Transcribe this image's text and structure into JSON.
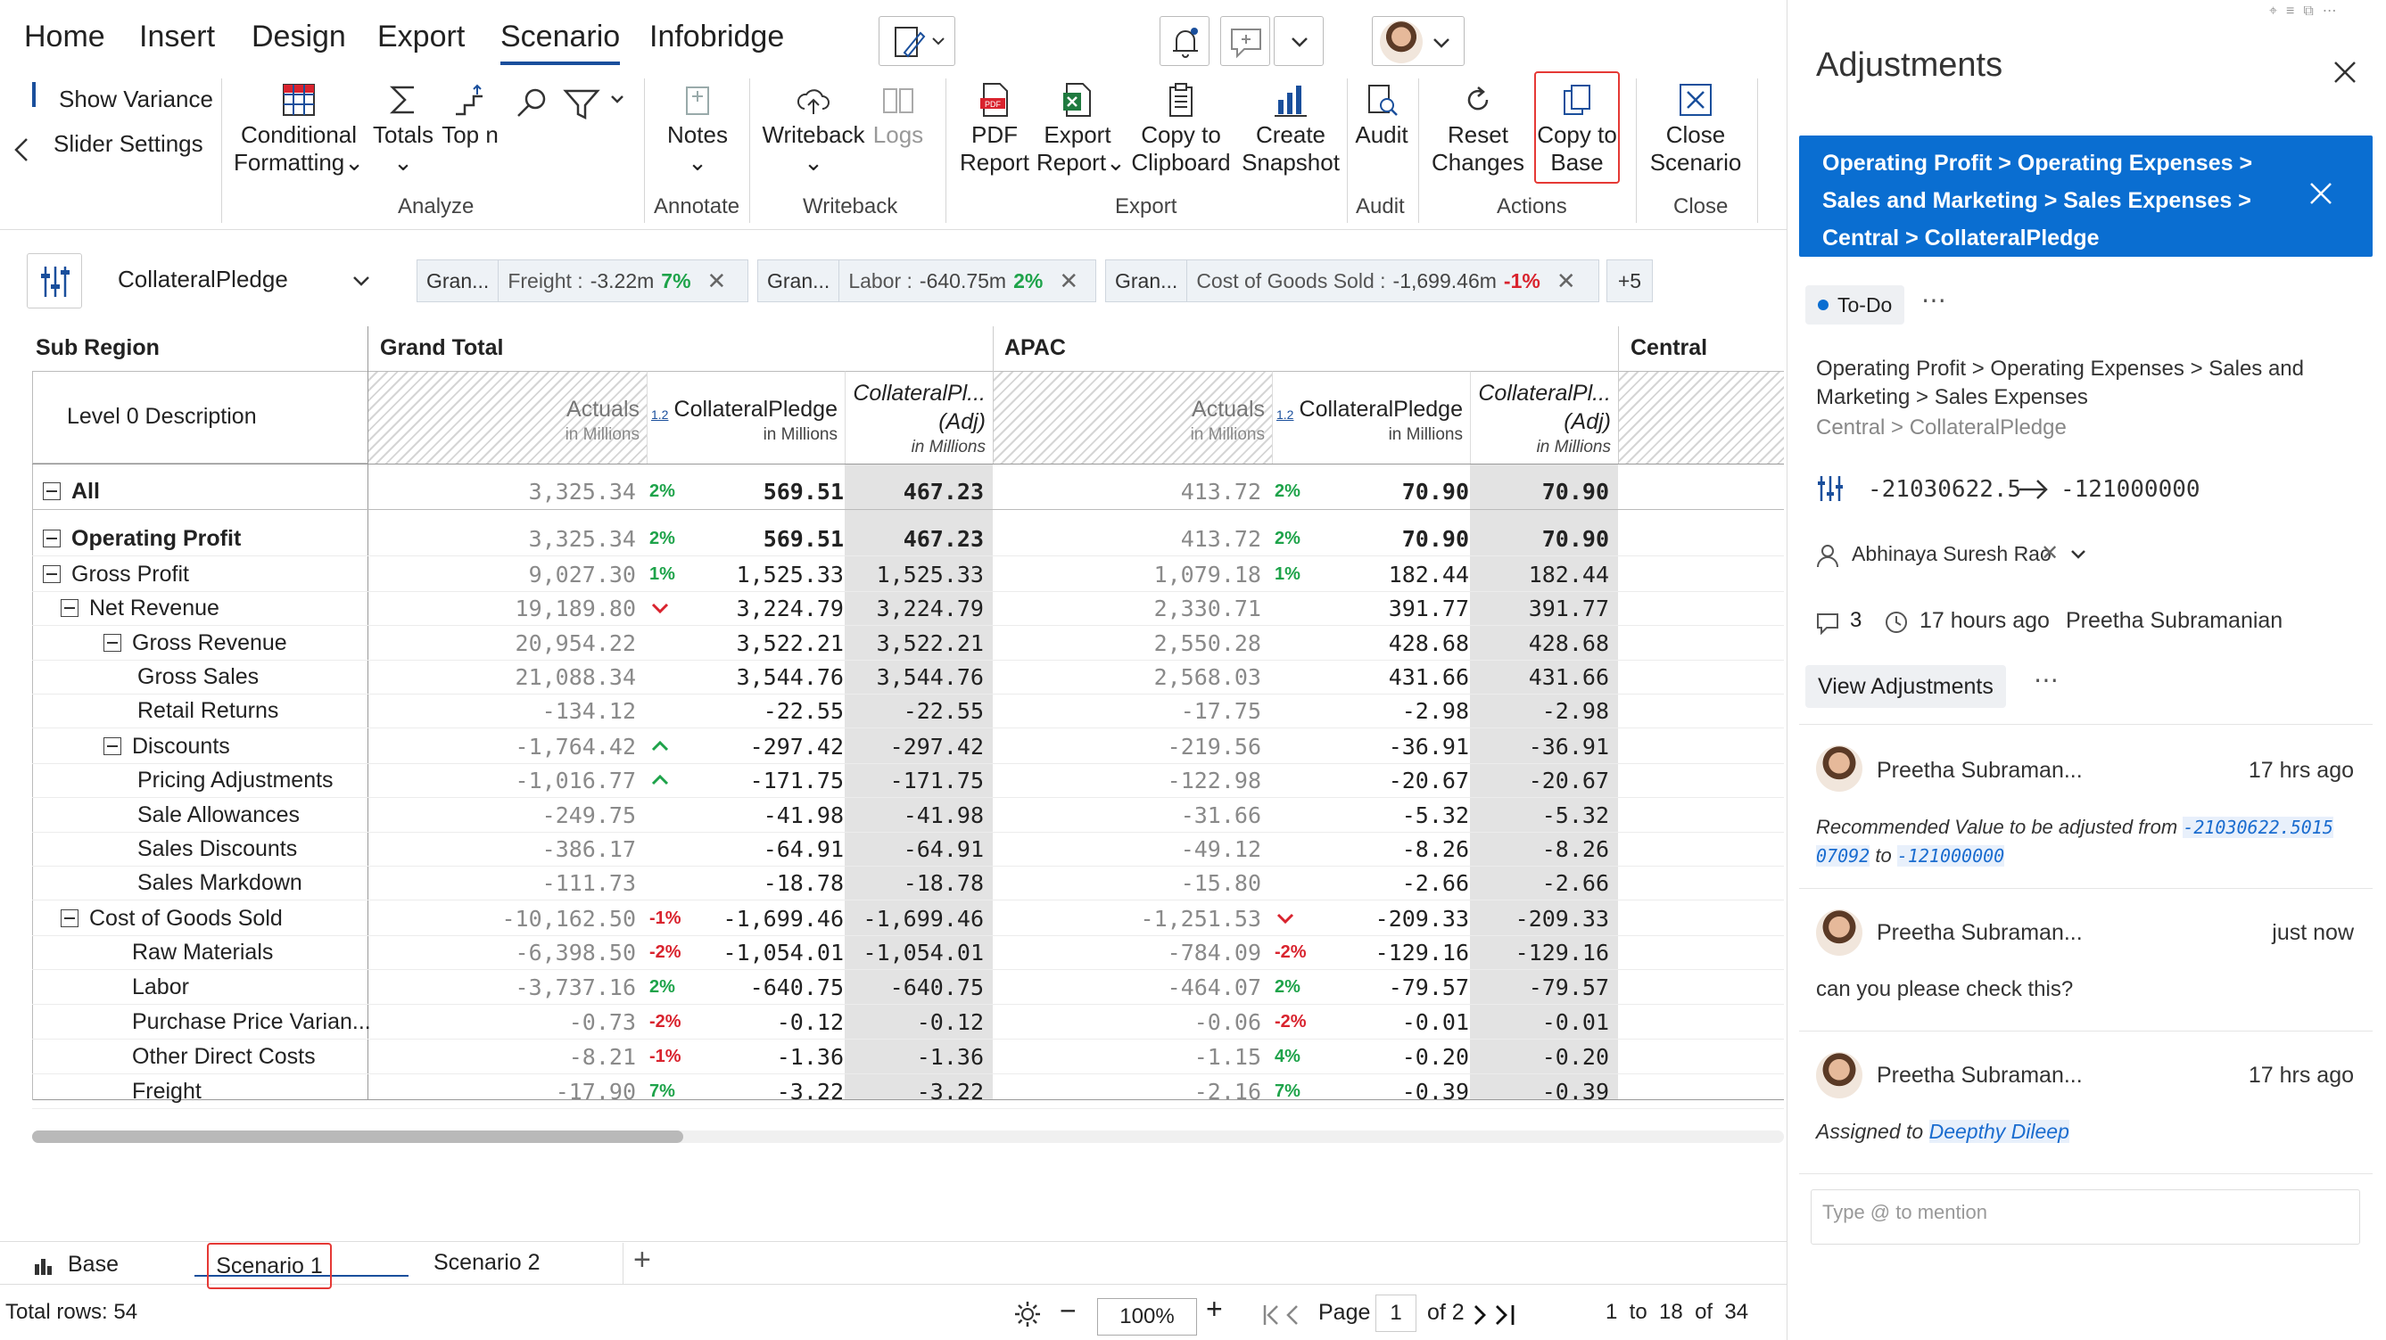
{
  "menu": {
    "tabs": [
      "Home",
      "Insert",
      "Design",
      "Export",
      "Scenario",
      "Infobridge"
    ],
    "active": "Scenario"
  },
  "ribbon": {
    "show_variance": "Show Variance",
    "slider_settings": "Slider Settings",
    "conditional_formatting": [
      "Conditional",
      "Formatting"
    ],
    "totals": "Totals",
    "top_n": "Top n",
    "notes": "Notes",
    "writeback": "Writeback",
    "logs": "Logs",
    "pdf_report": [
      "PDF",
      "Report"
    ],
    "export_report": [
      "Export",
      "Report"
    ],
    "copy_clipboard": [
      "Copy to",
      "Clipboard"
    ],
    "create_snapshot": [
      "Create",
      "Snapshot"
    ],
    "audit": "Audit",
    "reset_changes": [
      "Reset",
      "Changes"
    ],
    "copy_to_base": [
      "Copy to",
      "Base"
    ],
    "close_scenario": [
      "Close",
      "Scenario"
    ],
    "groups": {
      "analyze": "Analyze",
      "annotate": "Annotate",
      "writeback": "Writeback",
      "export": "Export",
      "audit": "Audit",
      "actions": "Actions",
      "close": "Close"
    }
  },
  "toolbar": {
    "measure_select": "CollateralPledge",
    "chips": [
      {
        "a": "Gran...",
        "label": "Freight :",
        "value": "-3.22m",
        "pct": "7%"
      },
      {
        "a": "Gran...",
        "label": "Labor :",
        "value": "-640.75m",
        "pct": "2%"
      },
      {
        "a": "Gran...",
        "label": "Cost of Goods Sold :",
        "value": "-1,699.46m",
        "pct": "-1%"
      }
    ],
    "more_chips": "+5"
  },
  "table": {
    "sub_region": "Sub Region",
    "level_desc": "Level 0 Description",
    "groups": [
      "Grand Total",
      "APAC",
      "Central"
    ],
    "col_actuals": "Actuals",
    "col_in_millions": "in Millions",
    "col_cp": "CollateralPledge",
    "col_cp_adj": "CollateralPl...",
    "col_adj": "(Adj)",
    "col_icon": "1.2",
    "rows": [
      {
        "label": "All",
        "indent": 0,
        "exp": true,
        "bold": true,
        "gt_act": "3,325.34",
        "gt_pct": "2%",
        "gt_cp": "569.51",
        "gt_adj": "467.23",
        "ap_act": "413.72",
        "ap_pct": "2%",
        "ap_cp": "70.90",
        "ap_adj": "70.90"
      },
      {
        "label": "Operating Profit",
        "indent": 0,
        "exp": true,
        "bold": true,
        "gt_act": "3,325.34",
        "gt_pct": "2%",
        "gt_cp": "569.51",
        "gt_adj": "467.23",
        "ap_act": "413.72",
        "ap_pct": "2%",
        "ap_cp": "70.90",
        "ap_adj": "70.90"
      },
      {
        "label": "Gross Profit",
        "indent": 1,
        "exp": true,
        "gt_act": "9,027.30",
        "gt_pct": "1%",
        "gt_cp": "1,525.33",
        "gt_adj": "1,525.33",
        "ap_act": "1,079.18",
        "ap_pct": "1%",
        "ap_cp": "182.44",
        "ap_adj": "182.44"
      },
      {
        "label": "Net Revenue",
        "indent": 2,
        "exp": true,
        "gt_act": "19,189.80",
        "gt_pct": "v",
        "gt_cp": "3,224.79",
        "gt_adj": "3,224.79",
        "ap_act": "2,330.71",
        "ap_pct": "",
        "ap_cp": "391.77",
        "ap_adj": "391.77"
      },
      {
        "label": "Gross Revenue",
        "indent": 3,
        "exp": true,
        "gt_act": "20,954.22",
        "gt_pct": "",
        "gt_cp": "3,522.21",
        "gt_adj": "3,522.21",
        "ap_act": "2,550.28",
        "ap_pct": "",
        "ap_cp": "428.68",
        "ap_adj": "428.68"
      },
      {
        "label": "Gross Sales",
        "indent": 4,
        "gt_act": "21,088.34",
        "gt_pct": "",
        "gt_cp": "3,544.76",
        "gt_adj": "3,544.76",
        "ap_act": "2,568.03",
        "ap_pct": "",
        "ap_cp": "431.66",
        "ap_adj": "431.66"
      },
      {
        "label": "Retail Returns",
        "indent": 4,
        "gt_act": "-134.12",
        "gt_pct": "",
        "gt_cp": "-22.55",
        "gt_adj": "-22.55",
        "ap_act": "-17.75",
        "ap_pct": "",
        "ap_cp": "-2.98",
        "ap_adj": "-2.98"
      },
      {
        "label": "Discounts",
        "indent": 3,
        "exp": true,
        "gt_act": "-1,764.42",
        "gt_pct": "^",
        "gt_cp": "-297.42",
        "gt_adj": "-297.42",
        "ap_act": "-219.56",
        "ap_pct": "",
        "ap_cp": "-36.91",
        "ap_adj": "-36.91"
      },
      {
        "label": "Pricing Adjustments",
        "indent": 4,
        "gt_act": "-1,016.77",
        "gt_pct": "^",
        "gt_cp": "-171.75",
        "gt_adj": "-171.75",
        "ap_act": "-122.98",
        "ap_pct": "",
        "ap_cp": "-20.67",
        "ap_adj": "-20.67"
      },
      {
        "label": "Sale Allowances",
        "indent": 4,
        "gt_act": "-249.75",
        "gt_pct": "",
        "gt_cp": "-41.98",
        "gt_adj": "-41.98",
        "ap_act": "-31.66",
        "ap_pct": "",
        "ap_cp": "-5.32",
        "ap_adj": "-5.32"
      },
      {
        "label": "Sales Discounts",
        "indent": 4,
        "gt_act": "-386.17",
        "gt_pct": "",
        "gt_cp": "-64.91",
        "gt_adj": "-64.91",
        "ap_act": "-49.12",
        "ap_pct": "",
        "ap_cp": "-8.26",
        "ap_adj": "-8.26"
      },
      {
        "label": "Sales Markdown",
        "indent": 4,
        "gt_act": "-111.73",
        "gt_pct": "",
        "gt_cp": "-18.78",
        "gt_adj": "-18.78",
        "ap_act": "-15.80",
        "ap_pct": "",
        "ap_cp": "-2.66",
        "ap_adj": "-2.66"
      },
      {
        "label": "Cost of Goods Sold",
        "indent": 2,
        "exp": true,
        "gt_act": "-10,162.50",
        "gt_pct": "-1%",
        "gt_cp": "-1,699.46",
        "gt_adj": "-1,699.46",
        "ap_act": "-1,251.53",
        "ap_pct": "v",
        "ap_cp": "-209.33",
        "ap_adj": "-209.33"
      },
      {
        "label": "Raw Materials",
        "indent": 3,
        "gt_act": "-6,398.50",
        "gt_pct": "-2%",
        "gt_cp": "-1,054.01",
        "gt_adj": "-1,054.01",
        "ap_act": "-784.09",
        "ap_pct": "-2%",
        "ap_cp": "-129.16",
        "ap_adj": "-129.16"
      },
      {
        "label": "Labor",
        "indent": 3,
        "gt_act": "-3,737.16",
        "gt_pct": "2%",
        "gt_cp": "-640.75",
        "gt_adj": "-640.75",
        "ap_act": "-464.07",
        "ap_pct": "2%",
        "ap_cp": "-79.57",
        "ap_adj": "-79.57"
      },
      {
        "label": "Purchase Price Varian...",
        "indent": 3,
        "gt_act": "-0.73",
        "gt_pct": "-2%",
        "gt_cp": "-0.12",
        "gt_adj": "-0.12",
        "ap_act": "-0.06",
        "ap_pct": "-2%",
        "ap_cp": "-0.01",
        "ap_adj": "-0.01"
      },
      {
        "label": "Other Direct Costs",
        "indent": 3,
        "gt_act": "-8.21",
        "gt_pct": "-1%",
        "gt_cp": "-1.36",
        "gt_adj": "-1.36",
        "ap_act": "-1.15",
        "ap_pct": "4%",
        "ap_cp": "-0.20",
        "ap_adj": "-0.20"
      },
      {
        "label": "Freight",
        "indent": 3,
        "gt_act": "-17.90",
        "gt_pct": "7%",
        "gt_cp": "-3.22",
        "gt_adj": "-3.22",
        "ap_act": "-2.16",
        "ap_pct": "7%",
        "ap_cp": "-0.39",
        "ap_adj": "-0.39"
      }
    ]
  },
  "bottom_tabs": {
    "base": "Base",
    "scenario1": "Scenario 1",
    "scenario2": "Scenario 2",
    "add": "+"
  },
  "status": {
    "total_rows": "Total rows: 54",
    "zoom": "100%",
    "page_label": "Page",
    "page_num": "1",
    "of_pages": "of 2",
    "range": "1  to  18  of  34"
  },
  "panel": {
    "title": "Adjustments",
    "banner": "Operating Profit > Operating Expenses > Sales and Marketing > Sales Expenses > Central > CollateralPledge",
    "status": "To-Do",
    "path1": "Operating Profit > Operating Expenses > Sales and Marketing > Sales Expenses",
    "path2": "Central > CollateralPledge",
    "from_value": "-21030622.5",
    "to_value": "-121000000",
    "assignee": "Abhinaya Suresh Rao",
    "comments_count": "3",
    "time_ago": "17 hours ago",
    "owner": "Preetha Subramanian",
    "view_adjustments": "View Adjustments",
    "comments": [
      {
        "name": "Preetha Subraman...",
        "time": "17 hrs ago",
        "pre": "Recommended Value to be adjusted from ",
        "val1": "-21030622.5015 07092",
        "mid": " to ",
        "val2": "-121000000"
      },
      {
        "name": "Preetha Subraman...",
        "time": "just now",
        "text": "can you please check this?"
      },
      {
        "name": "Preetha Subraman...",
        "time": "17 hrs ago",
        "pre": "Assigned to ",
        "link": "Deepthy Dileep"
      }
    ],
    "input_placeholder": "Type @ to mention"
  }
}
